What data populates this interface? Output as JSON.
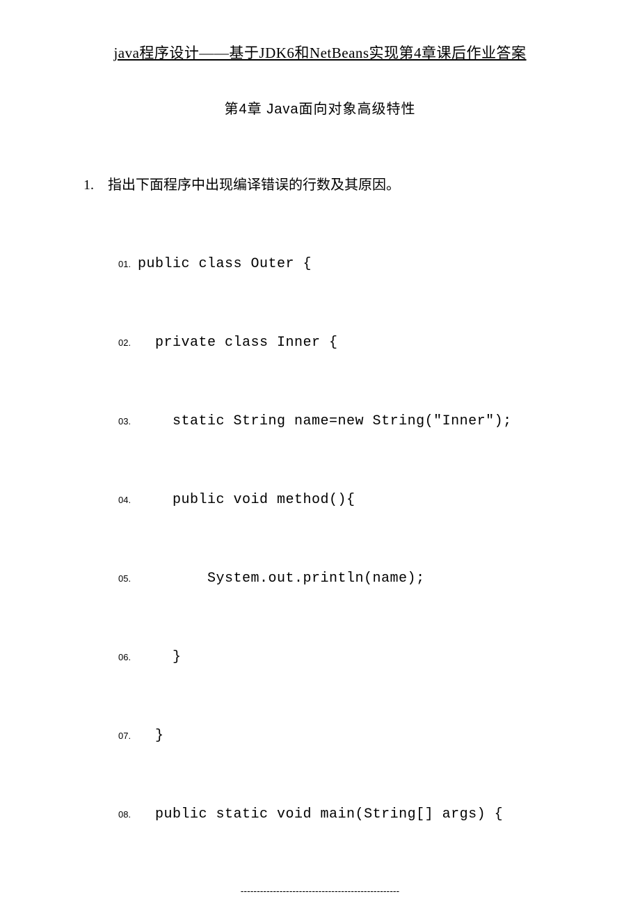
{
  "header": {
    "title": "java程序设计——基于JDK6和NetBeans实现第4章课后作业答案"
  },
  "chapter": {
    "title": "第4章   Java面向对象高级特性"
  },
  "question": {
    "number": "1.",
    "text": "指出下面程序中出现编译错误的行数及其原因。"
  },
  "code": {
    "lines": [
      {
        "num": "01.",
        "text": "public class Outer {",
        "indent": ""
      },
      {
        "num": "02.",
        "text": "private class Inner {",
        "indent": "  "
      },
      {
        "num": "03.",
        "text": "static String name=new String(\"Inner\");",
        "indent": "    "
      },
      {
        "num": "04.",
        "text": "public void method(){",
        "indent": "    "
      },
      {
        "num": "05.",
        "text": "System.out.println(name);",
        "indent": "        "
      },
      {
        "num": "06.",
        "text": "}",
        "indent": "    "
      },
      {
        "num": "07.",
        "text": "}",
        "indent": "  "
      },
      {
        "num": "08.",
        "text": "public static void main(String[] args) {",
        "indent": "  "
      }
    ]
  },
  "footer": {
    "dashes": "-------------------------------------------------"
  }
}
